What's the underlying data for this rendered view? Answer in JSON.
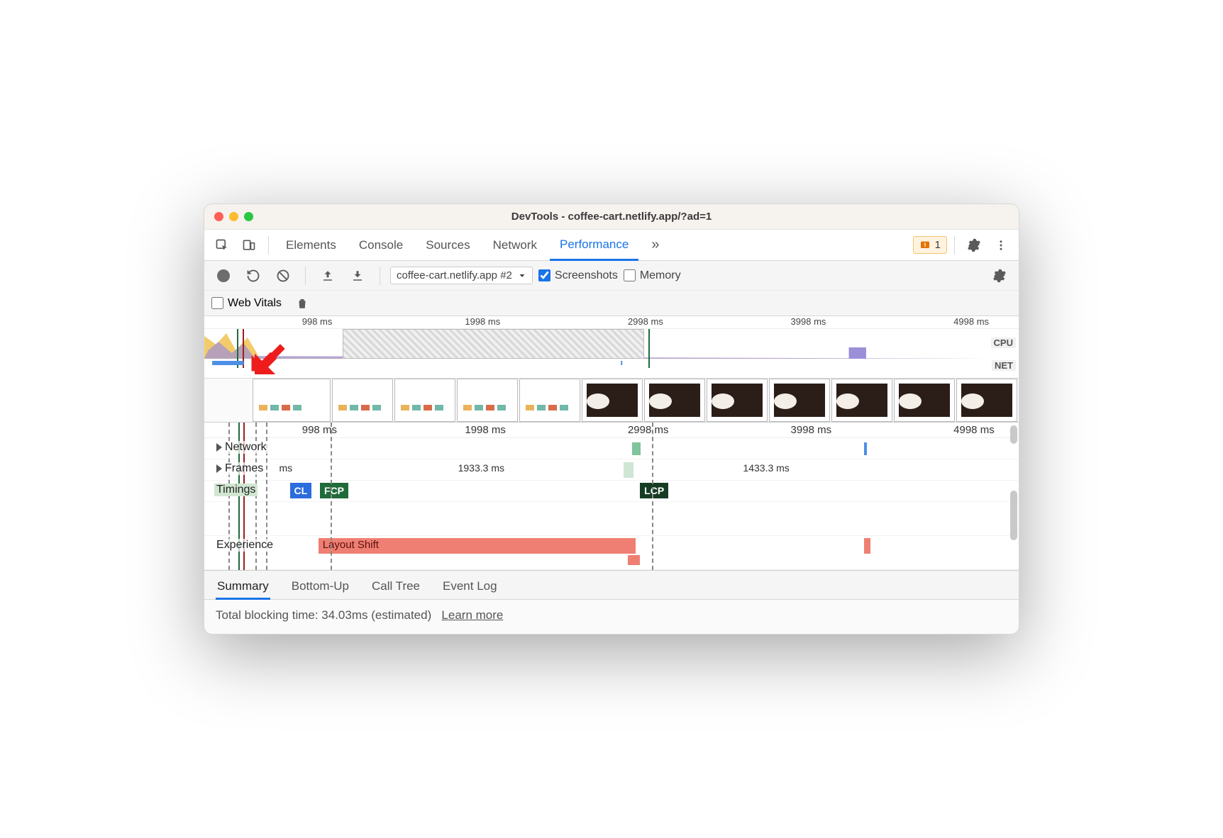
{
  "window": {
    "title": "DevTools - coffee-cart.netlify.app/?ad=1"
  },
  "tabs": {
    "items": [
      "Elements",
      "Console",
      "Sources",
      "Network",
      "Performance"
    ],
    "active": 4,
    "overflow_glyph": "»",
    "issues_count": "1"
  },
  "toolbar": {
    "recording_name": "coffee-cart.netlify.app #2",
    "screenshots": {
      "label": "Screenshots",
      "checked": true
    },
    "memory": {
      "label": "Memory",
      "checked": false
    }
  },
  "toolbar2": {
    "web_vitals": {
      "label": "Web Vitals",
      "checked": false
    }
  },
  "overview_ruler": {
    "ticks": [
      {
        "label": "998 ms",
        "pct": 12
      },
      {
        "label": "1998 ms",
        "pct": 32
      },
      {
        "label": "2998 ms",
        "pct": 52
      },
      {
        "label": "3998 ms",
        "pct": 72
      },
      {
        "label": "4998 ms",
        "pct": 92
      }
    ],
    "cpu_label": "CPU",
    "net_label": "NET"
  },
  "tracks_ruler": {
    "ticks": [
      {
        "label": "998 ms",
        "pct": 12
      },
      {
        "label": "1998 ms",
        "pct": 32
      },
      {
        "label": "2998 ms",
        "pct": 52
      },
      {
        "label": "3998 ms",
        "pct": 72
      },
      {
        "label": "4998 ms",
        "pct": 92
      }
    ]
  },
  "tracks": {
    "network_label": "Network",
    "frames_label": "Frames",
    "frames": [
      {
        "label": "ms",
        "left_pct": 8,
        "width_pct": 4
      },
      {
        "label": "1933.3 ms",
        "left_pct": 16,
        "width_pct": 36
      },
      {
        "label": "",
        "left_pct": 52,
        "width_pct": 3
      },
      {
        "label": "1433.3 ms",
        "left_pct": 56,
        "width_pct": 26
      }
    ],
    "timings_label": "Timings",
    "timings": [
      {
        "label": "CL",
        "color": "#2b6cde",
        "left_pct": 10.5
      },
      {
        "label": "FCP",
        "color": "#1f6b3a",
        "left_pct": 14.2
      },
      {
        "label": "LCP",
        "color": "#163d24",
        "left_pct": 53.5
      }
    ],
    "experience_label": "Experience",
    "experience": {
      "label": "Layout Shift",
      "left_pct": 14,
      "width_pct": 39
    }
  },
  "vlines": [
    {
      "pct": 3,
      "type": "dash"
    },
    {
      "pct": 4.2,
      "type": "solid",
      "color": "#1f6b3a"
    },
    {
      "pct": 4.8,
      "type": "solid",
      "color": "#9a1f1f"
    },
    {
      "pct": 6.3,
      "type": "dash"
    },
    {
      "pct": 7.6,
      "type": "dash"
    },
    {
      "pct": 15.5,
      "type": "dash"
    },
    {
      "pct": 55,
      "type": "dash"
    }
  ],
  "details": {
    "tabs": [
      "Summary",
      "Bottom-Up",
      "Call Tree",
      "Event Log"
    ],
    "active": 0,
    "summary_text": "Total blocking time: 34.03ms (estimated)",
    "learn_more": "Learn more"
  }
}
